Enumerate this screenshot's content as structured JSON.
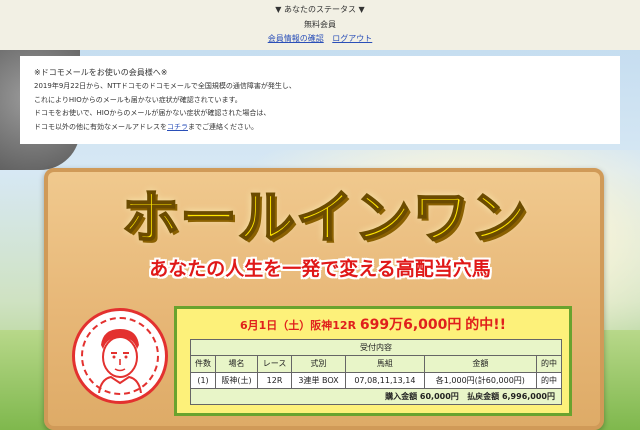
{
  "status": {
    "heading": "▼ あなたのステータス ▼",
    "membership": "無料会員",
    "links": [
      "会員情報の確認",
      "ログアウト"
    ]
  },
  "notice": {
    "title": "※ドコモメールをお使いの会員様へ※",
    "lines": [
      "2019年9月22日から、NTTドコモのドコモメールで全国規模の通信障害が発生し、",
      "これによりHIOからのメールも届かない症状が確認されています。",
      "ドコモをお使いで、HIOからのメールが届かない症状が確認された場合は、"
    ],
    "last_line_prefix": "ドコモ以外の他に有効なメールアドレスを",
    "last_line_link": "コチラ",
    "last_line_suffix": "までご連絡ください。"
  },
  "board": {
    "headline": "ホールインワン",
    "subheadline": "あなたの人生を一発で変える高配当穴馬"
  },
  "result": {
    "win_prefix": "6月1日（土）阪神12R",
    "win_amount": "699万6,000円",
    "win_suffix": "的中!!",
    "table_title": "受付内容",
    "columns": [
      "件数",
      "場名",
      "レース",
      "式別",
      "馬組",
      "金額",
      "的中"
    ],
    "row": [
      "(1)",
      "阪神(土)",
      "12R",
      "3連単 BOX",
      "07,08,11,13,14",
      "各1,000円(計60,000円)",
      "的中"
    ],
    "purchase_label": "購入金額",
    "purchase_value": "60,000円",
    "payout_label": "払戻金額",
    "payout_value": "6,996,000円"
  },
  "colors": {
    "accent_red": "#e01818",
    "headline_yellow": "#ffe600",
    "panel_yellow": "#fdf17a",
    "panel_green": "#69a32e",
    "link_blue": "#2a4fb8"
  },
  "icons": [
    "portrait-seal-icon"
  ]
}
